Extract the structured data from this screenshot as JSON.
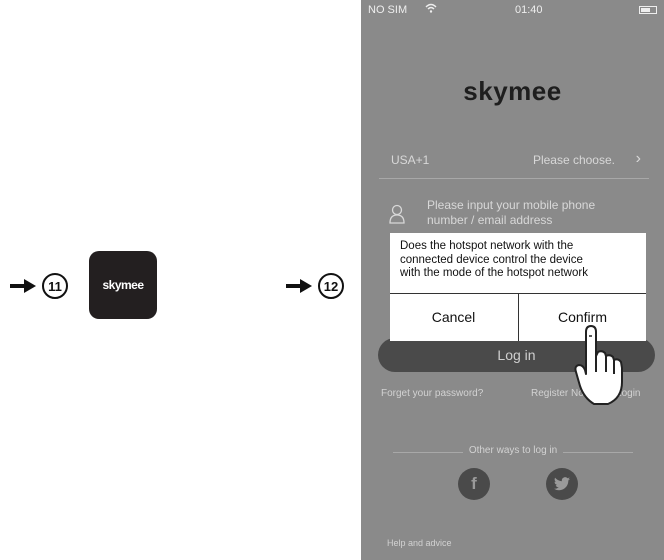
{
  "steps": [
    {
      "number": "11"
    },
    {
      "number": "12"
    }
  ],
  "app_icon": {
    "label": "skymee"
  },
  "status_bar": {
    "carrier": "NO SIM",
    "time": "01:40"
  },
  "login_screen": {
    "brand": "skymee",
    "country_code": "USA+1",
    "country_choose": "Please choose.",
    "account_placeholder_line1": "Please input your mobile phone",
    "account_placeholder_line2": "number / email address",
    "login_button": "Log in",
    "forgot_password": "Forget your password?",
    "register": "Register Now/Fast Login",
    "other_ways": "Other ways to log in",
    "facebook_glyph": "f",
    "twitter_glyph": "t",
    "help": "Help and advice"
  },
  "dialog": {
    "message_line1": "Does the hotspot network with the",
    "message_line2": "connected device control the device",
    "message_line3": "with the mode of the hotspot network",
    "cancel_label": "Cancel",
    "confirm_label": "Confirm"
  },
  "icons": [
    "arrow-right-icon",
    "wifi-icon",
    "battery-icon",
    "chevron-right-icon",
    "user-icon",
    "facebook-icon",
    "twitter-icon",
    "pointing-hand-icon"
  ]
}
